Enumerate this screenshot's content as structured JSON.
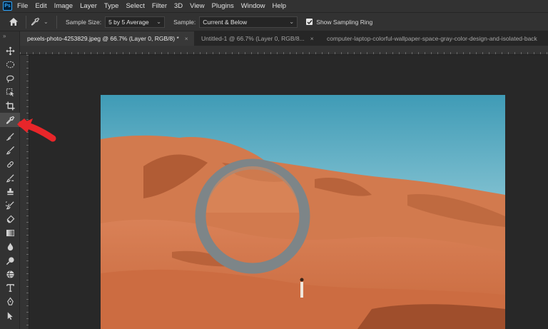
{
  "app": {
    "logo_text": "Ps"
  },
  "menu": [
    "File",
    "Edit",
    "Image",
    "Layer",
    "Type",
    "Select",
    "Filter",
    "3D",
    "View",
    "Plugins",
    "Window",
    "Help"
  ],
  "options": {
    "sample_size_label": "Sample Size:",
    "sample_size_value": "5 by 5 Average",
    "sample_label": "Sample:",
    "sample_value": "Current & Below",
    "show_ring_label": "Show Sampling Ring",
    "show_ring_checked": true
  },
  "tabs": [
    {
      "label": "pexels-photo-4253829.jpeg @ 66.7% (Layer 0, RGB/8) *",
      "active": true,
      "close": "×"
    },
    {
      "label": "Untitled-1 @ 66.7% (Layer 0, RGB/8...",
      "active": false,
      "close": "×"
    },
    {
      "label": "computer-laptop-colorful-wallpaper-space-gray-color-design-and-isolated-back",
      "active": false,
      "close": ""
    }
  ],
  "toolbar": {
    "collapse_glyph": "»",
    "tools": [
      "move",
      "marquee",
      "lasso",
      "object-select",
      "crop",
      "eyedropper",
      "healing-brush",
      "brush",
      "clone-stamp",
      "history-brush",
      "eraser",
      "gradient",
      "blur",
      "dodge",
      "pen",
      "type",
      "path-select"
    ],
    "active_tool": "eyedropper"
  },
  "colors": {
    "accent_arrow": "#e8262a",
    "sky_top": "#3f9bb6",
    "sky_bottom": "#c9e6ec",
    "sand": "#d9774a",
    "ring": "#7d8588"
  }
}
